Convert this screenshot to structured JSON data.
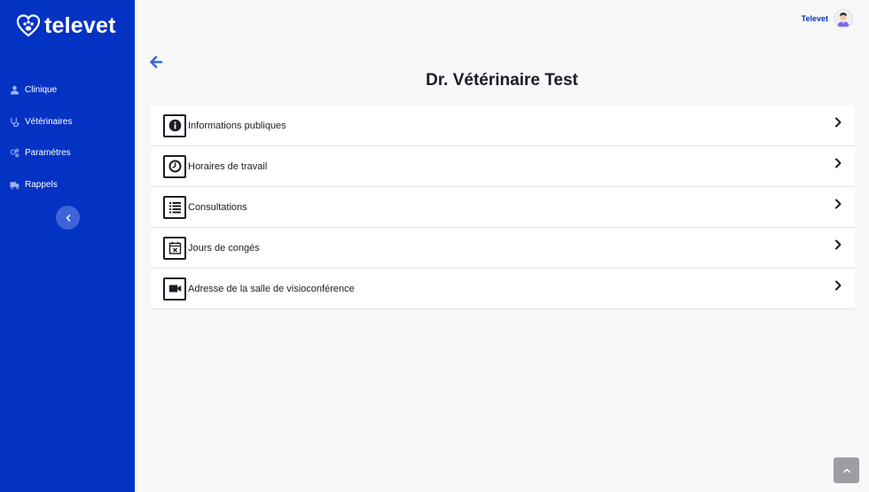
{
  "sidebar": {
    "brand": "televet",
    "items": [
      {
        "label": "Clinique",
        "icon": "user-icon"
      },
      {
        "label": "Vétérinaires",
        "icon": "stethoscope-icon"
      },
      {
        "label": "Paramètres",
        "icon": "cogs-icon"
      },
      {
        "label": "Rappels",
        "icon": "truck-icon"
      }
    ],
    "collapse_icon": "chevron-left-icon"
  },
  "header": {
    "user_name": "Televet",
    "avatar_icon": "avatar-icon"
  },
  "main": {
    "back_icon": "arrow-left-icon",
    "title": "Dr. Vétérinaire Test",
    "menu": [
      {
        "label": "Informations publiques",
        "icon": "info-icon"
      },
      {
        "label": "Horaires de travail",
        "icon": "clock-icon"
      },
      {
        "label": "Consultations",
        "icon": "list-icon"
      },
      {
        "label": "Jours de congés",
        "icon": "calendar-x-icon"
      },
      {
        "label": "Adresse de la salle de visioconférence",
        "icon": "video-camera-icon"
      }
    ]
  },
  "scroll_top_icon": "chevron-up-icon",
  "colors": {
    "sidebar_bg": "#0433c4",
    "accent": "#0433c4",
    "back_arrow": "#3d64d8",
    "page_bg": "#f8f8f9",
    "scroll_btn": "#9c9ea3"
  }
}
